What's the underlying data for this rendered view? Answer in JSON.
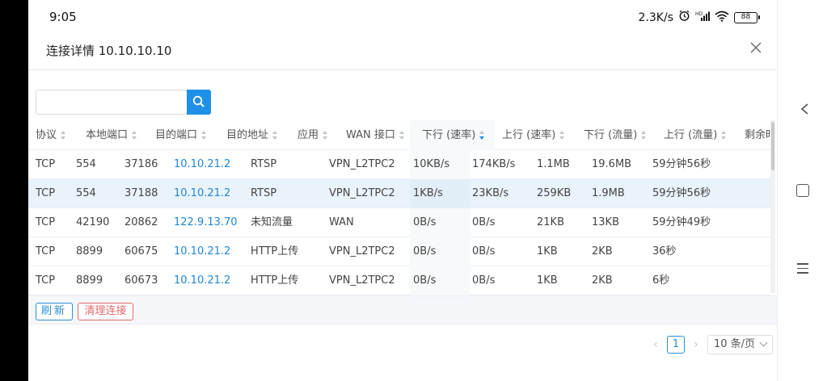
{
  "status_bar": {
    "time": "9:05",
    "speed": "2.3K/s",
    "battery": "88"
  },
  "header": {
    "title": "连接详情 10.10.10.10",
    "close_icon": "close-icon"
  },
  "search": {
    "value": "",
    "placeholder": "",
    "button_icon": "search-icon",
    "button_color": "#1e90e8"
  },
  "table": {
    "columns": [
      "协议",
      "本地端口",
      "目的端口",
      "目的地址",
      "应用",
      "WAN 接口",
      "下行 (速率)",
      "上行 (速率)",
      "下行 (流量)",
      "上行 (流量)",
      "剩余时"
    ],
    "sorted_column": "下行 (速率)",
    "sort_direction": "desc",
    "rows": [
      [
        "TCP",
        "554",
        "37186",
        "10.10.21.2",
        "RTSP",
        "VPN_L2TPC2",
        "10KB/s",
        "174KB/s",
        "1.1MB",
        "19.6MB",
        "59分钟56秒"
      ],
      [
        "TCP",
        "554",
        "37188",
        "10.10.21.2",
        "RTSP",
        "VPN_L2TPC2",
        "1KB/s",
        "23KB/s",
        "259KB",
        "1.9MB",
        "59分钟56秒"
      ],
      [
        "TCP",
        "42190",
        "20862",
        "122.9.13.70",
        "未知流量",
        "WAN",
        "0B/s",
        "0B/s",
        "21KB",
        "13KB",
        "59分钟49秒"
      ],
      [
        "TCP",
        "8899",
        "60675",
        "10.10.21.2",
        "HTTP上传",
        "VPN_L2TPC2",
        "0B/s",
        "0B/s",
        "1KB",
        "2KB",
        "36秒"
      ],
      [
        "TCP",
        "8899",
        "60673",
        "10.10.21.2",
        "HTTP上传",
        "VPN_L2TPC2",
        "0B/s",
        "0B/s",
        "1KB",
        "2KB",
        "6秒"
      ]
    ],
    "link_color": "#1e87d8",
    "highlight_row": 1
  },
  "actions": {
    "refresh_label": "刷新",
    "clear_label": "清理连接"
  },
  "pagination": {
    "current_page": "1",
    "page_size": "10 条/页"
  },
  "nav_icons": [
    "back-icon",
    "home-icon",
    "menu-icon"
  ]
}
